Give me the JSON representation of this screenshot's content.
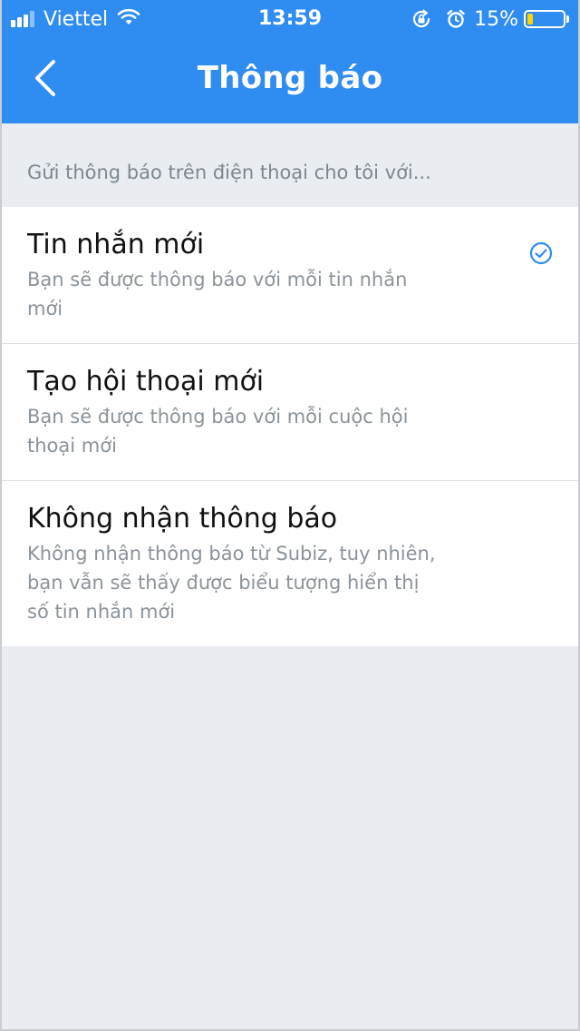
{
  "status_bar": {
    "carrier": "Viettel",
    "time": "13:59",
    "battery_percent": "15%",
    "battery_level": 0.15,
    "signal_bars": 4,
    "signal_full": 3
  },
  "header": {
    "title": "Thông báo",
    "back_icon": "chevron-left-icon"
  },
  "section": {
    "label": "Gửi thông báo trên điện thoại cho tôi với..."
  },
  "options": [
    {
      "title": "Tin nhắn mới",
      "description": "Bạn sẽ được thông báo với mỗi tin nhắn mới",
      "selected": true
    },
    {
      "title": "Tạo hội thoại mới",
      "description": "Bạn sẽ được thông báo với mỗi cuộc hội thoại mới",
      "selected": false
    },
    {
      "title": "Không nhận thông báo",
      "description": "Không nhận thông báo từ Subiz, tuy nhiên, bạn vẫn sẽ thấy được biểu tượng hiển thị số tin nhắn mới",
      "selected": false
    }
  ],
  "colors": {
    "header_bg": "#2f8cf0",
    "page_bg": "#e9ecf1",
    "check": "#2f8cf0",
    "battery_low": "#ffd400"
  }
}
